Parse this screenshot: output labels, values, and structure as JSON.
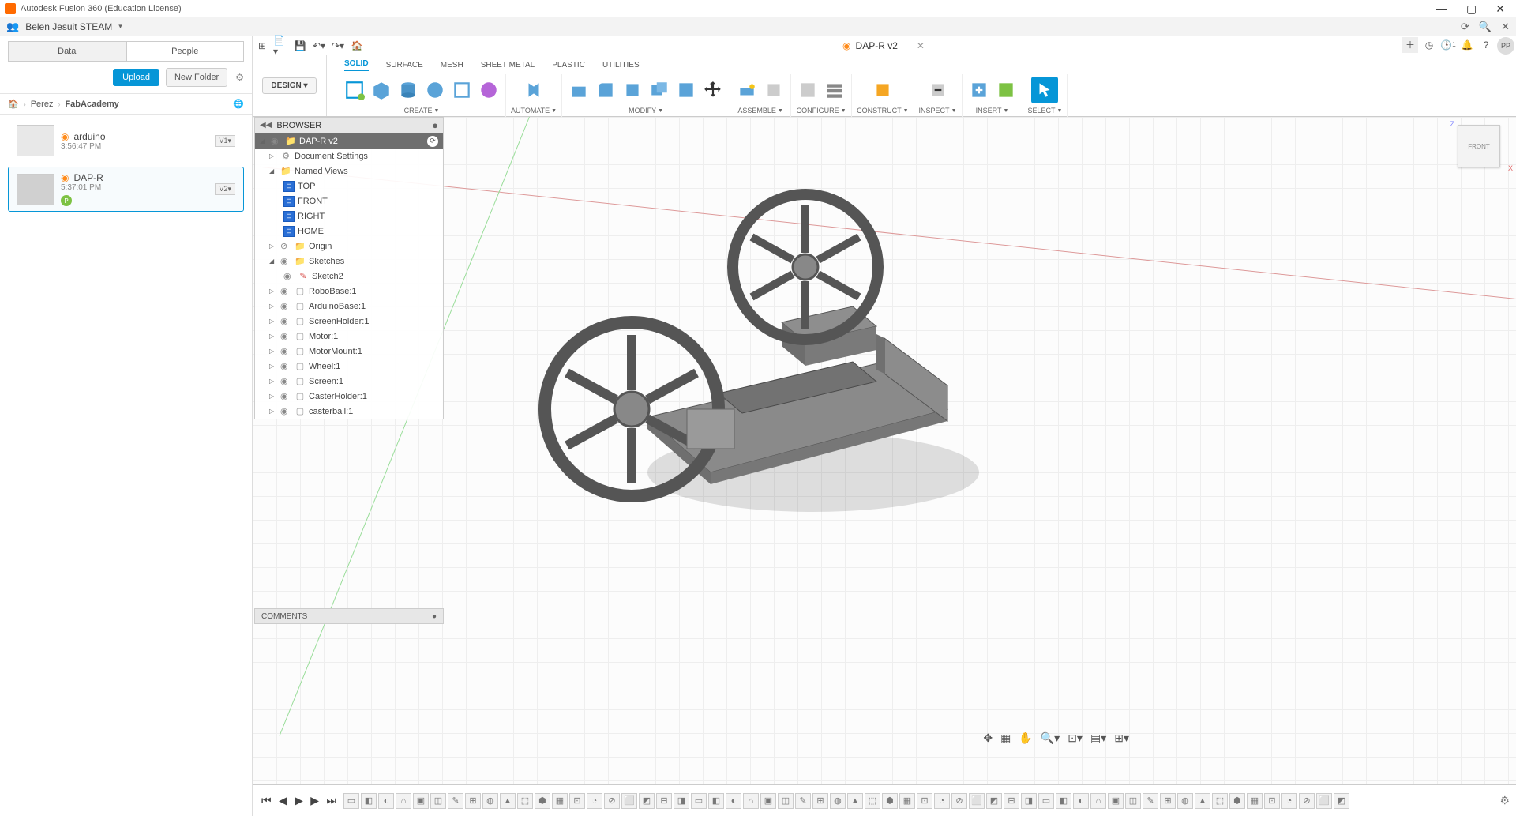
{
  "titlebar": {
    "title": "Autodesk Fusion 360 (Education License)"
  },
  "teambar": {
    "name": "Belen Jesuit STEAM"
  },
  "active_tab": {
    "name": "DAP-R v2"
  },
  "toprighticons": {
    "notif_count": "1",
    "avatar": "PP"
  },
  "ribbon": {
    "design": "DESIGN",
    "tabs": [
      "SOLID",
      "SURFACE",
      "MESH",
      "SHEET METAL",
      "PLASTIC",
      "UTILITIES"
    ],
    "groups": [
      "CREATE",
      "AUTOMATE",
      "MODIFY",
      "ASSEMBLE",
      "CONFIGURE",
      "CONSTRUCT",
      "INSPECT",
      "INSERT",
      "SELECT"
    ]
  },
  "datapanel": {
    "tabs": [
      "Data",
      "People"
    ],
    "upload": "Upload",
    "newfolder": "New Folder",
    "crumbs": [
      "Perez",
      "FabAcademy"
    ],
    "files": [
      {
        "name": "arduino",
        "time": "3:56:47 PM",
        "ver": "V1"
      },
      {
        "name": "DAP-R",
        "time": "5:37:01 PM",
        "ver": "V2"
      }
    ]
  },
  "browser": {
    "title": "BROWSER",
    "root": "DAP-R v2",
    "docset": "Document Settings",
    "named": "Named Views",
    "views": [
      "TOP",
      "FRONT",
      "RIGHT",
      "HOME"
    ],
    "origin": "Origin",
    "sketches": "Sketches",
    "sketch": "Sketch2",
    "comps": [
      "RoboBase:1",
      "ArduinoBase:1",
      "ScreenHolder:1",
      "Motor:1",
      "MotorMount:1",
      "Wheel:1",
      "Screen:1",
      "CasterHolder:1",
      "casterball:1"
    ]
  },
  "comments": "COMMENTS"
}
